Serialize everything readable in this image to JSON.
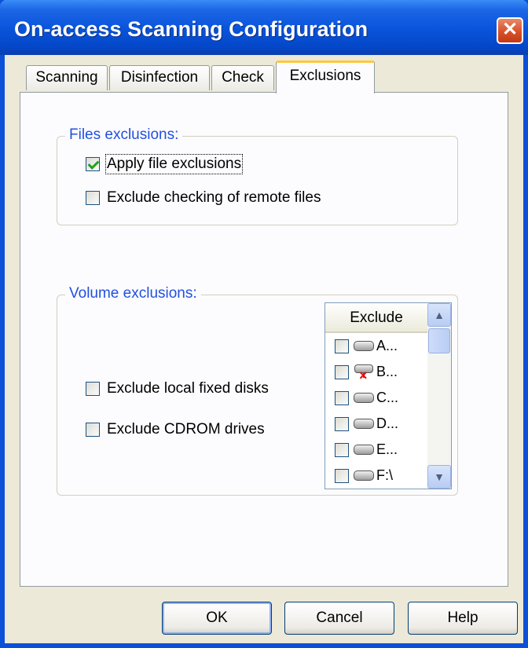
{
  "window": {
    "title": "On-access Scanning Configuration",
    "close_glyph": "✕"
  },
  "tabs": [
    {
      "label": "Scanning"
    },
    {
      "label": "Disinfection"
    },
    {
      "label": "Check"
    },
    {
      "label": "Exclusions",
      "selected": true
    }
  ],
  "files_exclusions": {
    "legend": "Files exclusions:",
    "apply_file_exclusions": {
      "label": "Apply file exclusions",
      "checked": true
    },
    "exclude_remote_files": {
      "label": "Exclude checking of remote files",
      "checked": false
    }
  },
  "volume_exclusions": {
    "legend": "Volume exclusions:",
    "exclude_local_fixed_disks": {
      "label": "Exclude local fixed disks",
      "checked": false
    },
    "exclude_cdrom_drives": {
      "label": "Exclude CDROM drives",
      "checked": false
    },
    "list": {
      "header": "Exclude",
      "rows": [
        {
          "label": "A...",
          "checked": false,
          "icon": "drive-icon"
        },
        {
          "label": "B...",
          "checked": false,
          "icon": "disconnected-network-drive-icon"
        },
        {
          "label": "C...",
          "checked": false,
          "icon": "drive-icon"
        },
        {
          "label": "D...",
          "checked": false,
          "icon": "drive-icon"
        },
        {
          "label": "E...",
          "checked": false,
          "icon": "drive-icon"
        },
        {
          "label": "F:\\",
          "checked": false,
          "icon": "drive-icon"
        }
      ]
    }
  },
  "buttons": {
    "ok": "OK",
    "cancel": "Cancel",
    "help": "Help"
  },
  "colors": {
    "title_bar": "#0a55dc",
    "group_legend": "#2150e0",
    "active_tab_accent": "#ffc83c",
    "close_button": "#d8502a"
  }
}
